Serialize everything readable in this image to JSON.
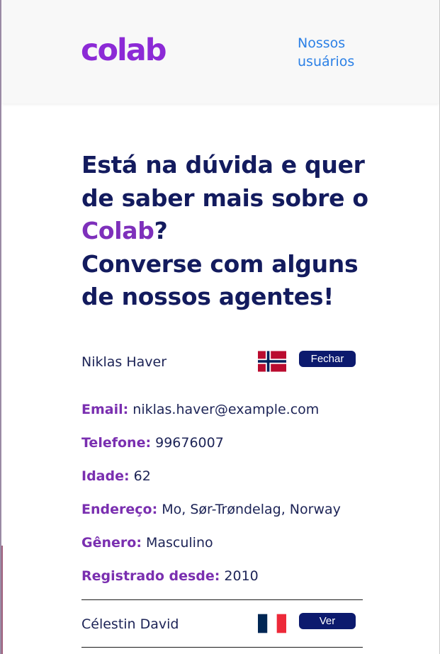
{
  "header": {
    "logo_text": "colab",
    "nav_link": "Nossos usuários"
  },
  "hero": {
    "line1": "Está na dúvida e quer de saber mais sobre o",
    "brand": "Colab",
    "after_brand": "?",
    "line2": "Converse com alguns de nossos agentes!"
  },
  "colors": {
    "brand": "#8c2ad6",
    "heading": "#131b5e",
    "link": "#2b80e6",
    "button": "#0c1a6e",
    "label": "#7a2fb0"
  },
  "agents": [
    {
      "name": "Niklas Haver",
      "flag_icon": "norway-flag-icon",
      "button_label": "Fechar",
      "expanded": true,
      "details": [
        {
          "label": "Email:",
          "value": "niklas.haver@example.com"
        },
        {
          "label": "Telefone:",
          "value": "99676007"
        },
        {
          "label": "Idade:",
          "value": "62"
        },
        {
          "label": "Endereço:",
          "value": "Mo, Sør-Trøndelag, Norway"
        },
        {
          "label": "Gênero:",
          "value": "Masculino"
        },
        {
          "label": "Registrado desde:",
          "value": "2010"
        }
      ]
    },
    {
      "name": "Célestin David",
      "flag_icon": "france-flag-icon",
      "button_label": "Ver",
      "expanded": false
    }
  ]
}
